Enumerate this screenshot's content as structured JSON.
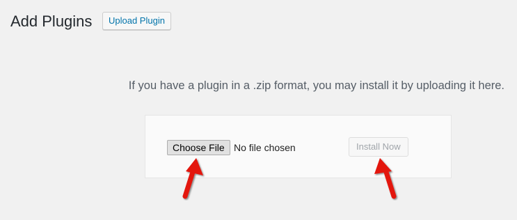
{
  "header": {
    "title": "Add Plugins",
    "upload_button_label": "Upload Plugin"
  },
  "upload_panel": {
    "help_text": "If you have a plugin in a .zip format, you may install it by uploading it here.",
    "choose_file_label": "Choose File",
    "file_status": "No file chosen",
    "install_button_label": "Install Now",
    "install_button_disabled": true
  },
  "annotations": {
    "arrow_color": "#e3140d",
    "arrow_icon": "red-arrow-icon"
  },
  "colors": {
    "page_background": "#f1f1f1",
    "link_blue": "#0073aa",
    "text_dark": "#23282d",
    "text_muted": "#555d66",
    "disabled_text": "#a0a5aa"
  }
}
